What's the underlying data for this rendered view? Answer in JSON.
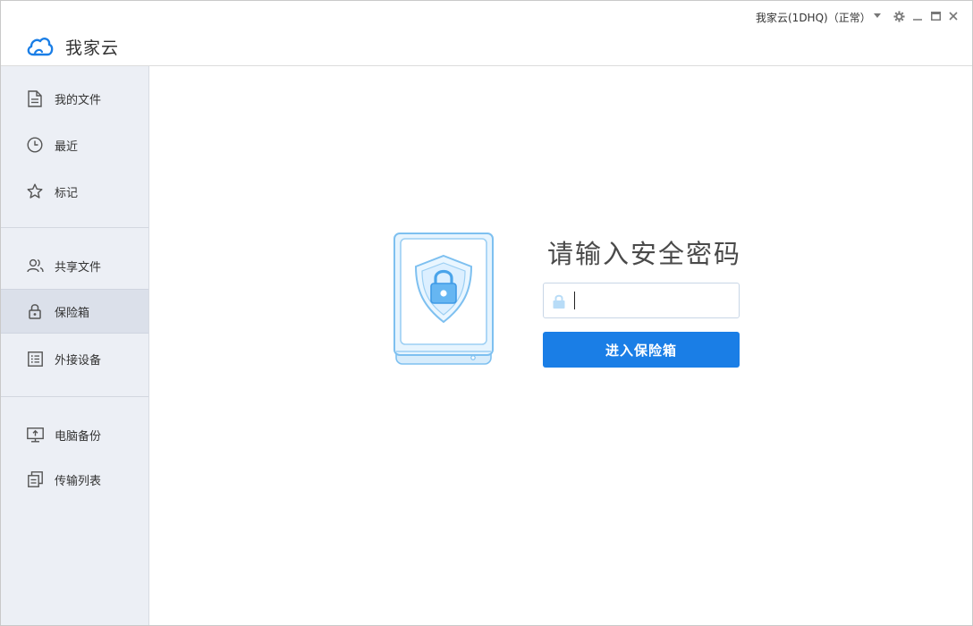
{
  "app": {
    "name": "我家云"
  },
  "header": {
    "account_label": "我家云(1DHQ)（正常）",
    "controls": [
      "dropdown-arrow",
      "settings",
      "minimize",
      "maximize",
      "close"
    ]
  },
  "sidebar": {
    "items": [
      {
        "label": "我的文件",
        "icon": "file-icon"
      },
      {
        "label": "最近",
        "icon": "clock-icon"
      },
      {
        "label": "标记",
        "icon": "star-icon"
      },
      {
        "label": "共享文件",
        "icon": "users-icon"
      },
      {
        "label": "保险箱",
        "icon": "lock-icon",
        "active": true
      },
      {
        "label": "外接设备",
        "icon": "list-icon"
      },
      {
        "label": "电脑备份",
        "icon": "monitor-upload-icon"
      },
      {
        "label": "传输列表",
        "icon": "transfer-list-icon"
      }
    ]
  },
  "vault": {
    "title": "请输入安全密码",
    "password_value": "",
    "enter_button": "进入保险箱"
  },
  "colors": {
    "accent": "#1a7ee6",
    "sidebar_bg": "#eceff5",
    "sidebar_active": "#dbe0ea",
    "illustration": "#7ec0f0"
  }
}
